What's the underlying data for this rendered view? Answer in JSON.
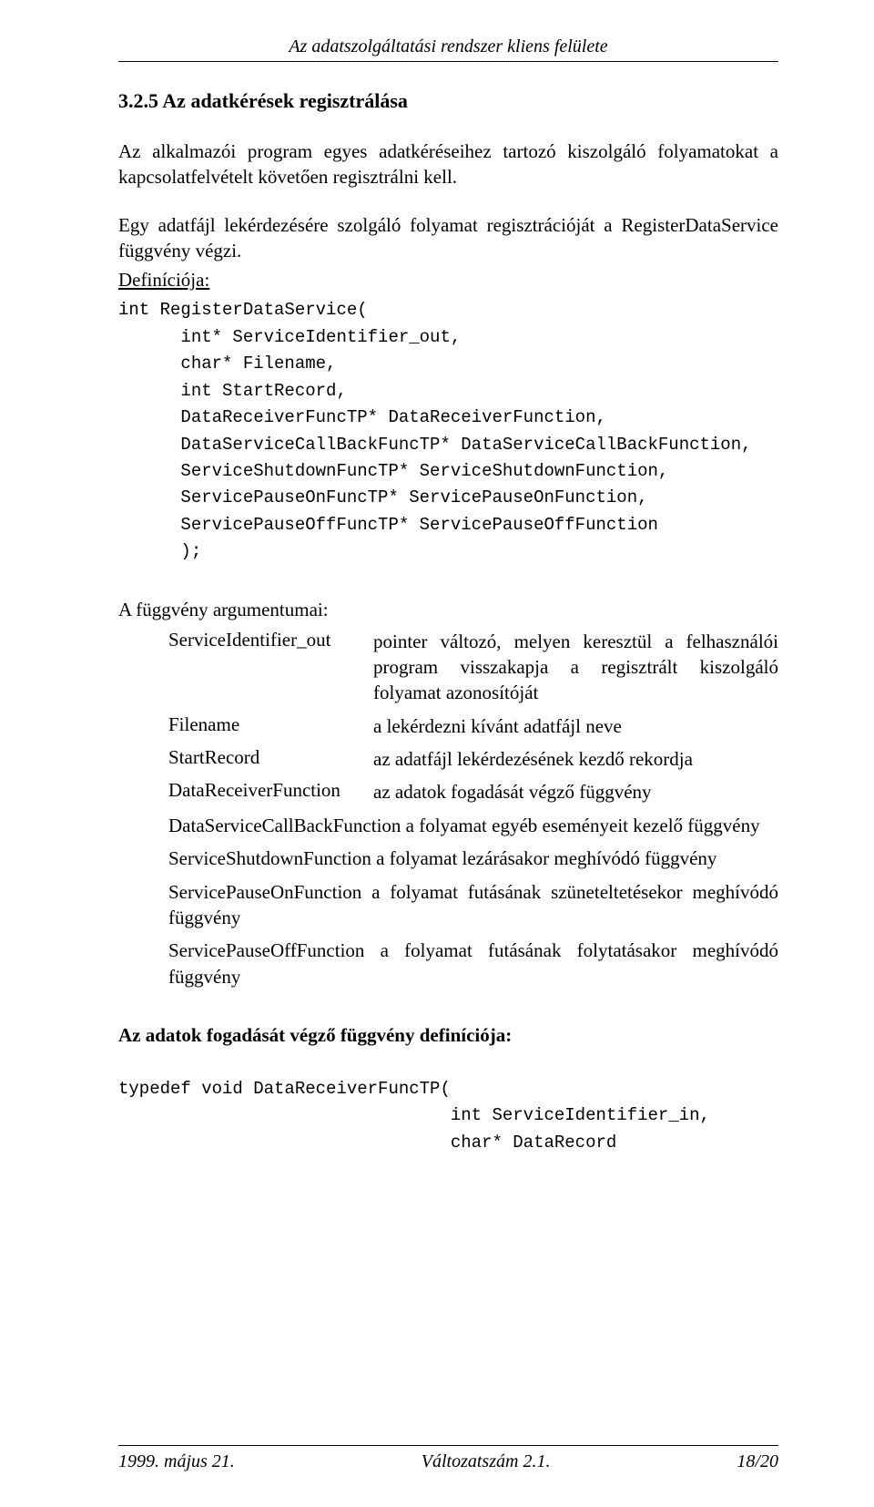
{
  "header": {
    "title_italic": "Az adatszolgáltatási rendszer kliens felülete"
  },
  "section": {
    "number_title": "3.2.5   Az adatkérések regisztrálása"
  },
  "paragraphs": {
    "p1": "Az alkalmazói program egyes adatkéréseihez tartozó kiszolgáló folyamatokat a kapcsolatfelvételt követően regisztrálni kell.",
    "p2": "Egy adatfájl lekérdezésére szolgáló folyamat regisztrációját a RegisterDataService függvény végzi.",
    "def_label": "Definíciója:"
  },
  "code": {
    "block": "int RegisterDataService(\n      int* ServiceIdentifier_out,\n      char* Filename,\n      int StartRecord,\n      DataReceiverFuncTP* DataReceiverFunction,\n      DataServiceCallBackFuncTP* DataServiceCallBackFunction,\n      ServiceShutdownFuncTP* ServiceShutdownFunction,\n      ServicePauseOnFuncTP* ServicePauseOnFunction,\n      ServicePauseOffFuncTP* ServicePauseOffFunction\n      );"
  },
  "args": {
    "title": "A függvény argumentumai:",
    "rows": [
      {
        "k": "ServiceIdentifier_out",
        "v": "pointer változó, melyen keresztül a felhasználói program visszakapja a regisztrált kiszolgáló folyamat azonosítóját"
      },
      {
        "k": "Filename",
        "v": "a lekérdezni kívánt adatfájl neve"
      },
      {
        "k": "StartRecord",
        "v": "az adatfájl lekérdezésének kezdő rekordja"
      },
      {
        "k": "DataReceiverFunction",
        "v": "az adatok fogadását végző függvény"
      }
    ],
    "lines": [
      "DataServiceCallBackFunction   a   folyamat   egyéb   eseményeit   kezelő függvény",
      "ServiceShutdownFunction    a folyamat lezárásakor meghívódó függvény",
      "ServicePauseOnFunction a folyamat futásának szüneteltetésekor meghívódó függvény",
      "ServicePauseOffFunction a  folyamat  futásának  folytatásakor  meghívódó függvény"
    ]
  },
  "subheading": "Az adatok fogadását végző függvény definíciója:",
  "code2": {
    "l1": "typedef void DataReceiverFuncTP(",
    "l2": "                                int ServiceIdentifier_in,",
    "l3": "                                char* DataRecord"
  },
  "footer": {
    "left": "1999. május 21.",
    "center": "Változatszám 2.1.",
    "right": "18/20"
  }
}
